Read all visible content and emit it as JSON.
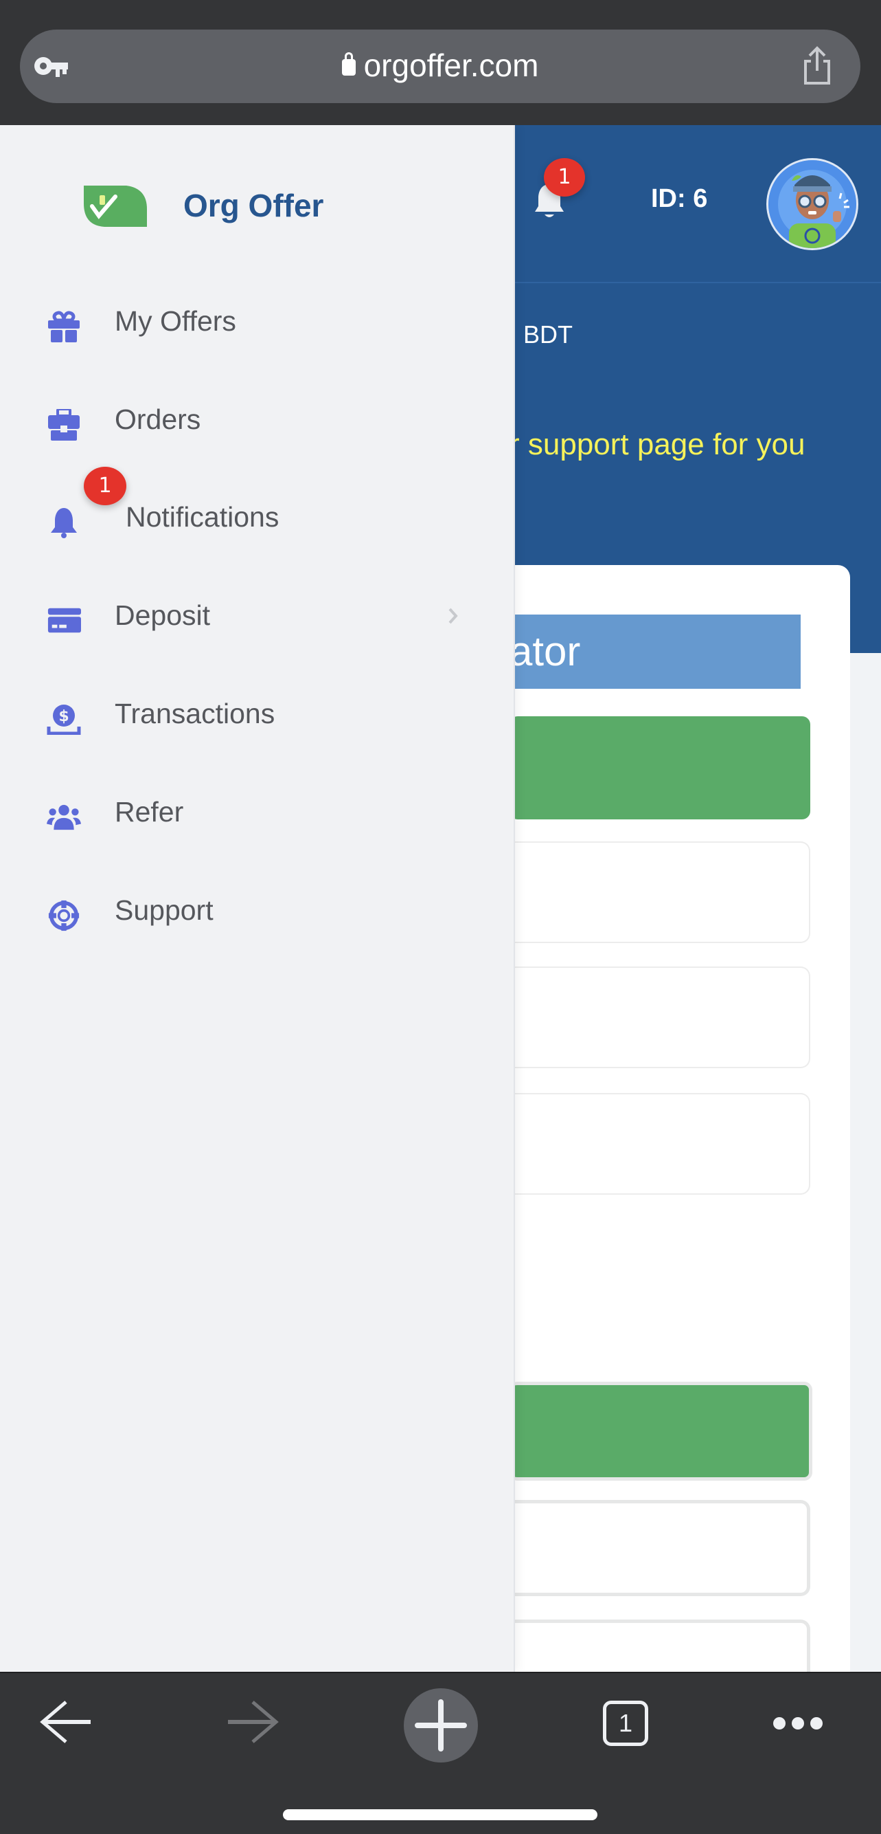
{
  "browser": {
    "url": "orgoffer.com",
    "tab_count": "1",
    "icons": {
      "key": "key-icon",
      "lock": "lock-icon",
      "share": "share-icon",
      "back": "arrow-left-icon",
      "forward": "arrow-right-icon",
      "new_tab": "plus-icon",
      "tabs": "tabs-icon",
      "more": "more-icon"
    }
  },
  "header": {
    "notification_count": "1",
    "user_id": "ID: 6",
    "balance_suffix": "BDT",
    "marquee_text": "r support page for you"
  },
  "card": {
    "title_fragment": "ator"
  },
  "drawer": {
    "brand": "Org Offer",
    "items": [
      {
        "label": "My Offers",
        "icon": "gift-icon"
      },
      {
        "label": "Orders",
        "icon": "briefcase-icon"
      },
      {
        "label": "Notifications",
        "icon": "bell-icon",
        "badge": "1"
      },
      {
        "label": "Deposit",
        "icon": "credit-card-icon",
        "has_submenu": true
      },
      {
        "label": "Transactions",
        "icon": "money-receive-icon"
      },
      {
        "label": "Refer",
        "icon": "users-icon"
      },
      {
        "label": "Support",
        "icon": "lifebuoy-icon"
      }
    ]
  },
  "colors": {
    "brand_blue": "#25568f",
    "accent_icon": "#5c6ad8",
    "success_green": "#5aab68",
    "badge_red": "#e4332b",
    "marquee_yellow": "#f6f25a",
    "title_blue": "#6699cf"
  }
}
